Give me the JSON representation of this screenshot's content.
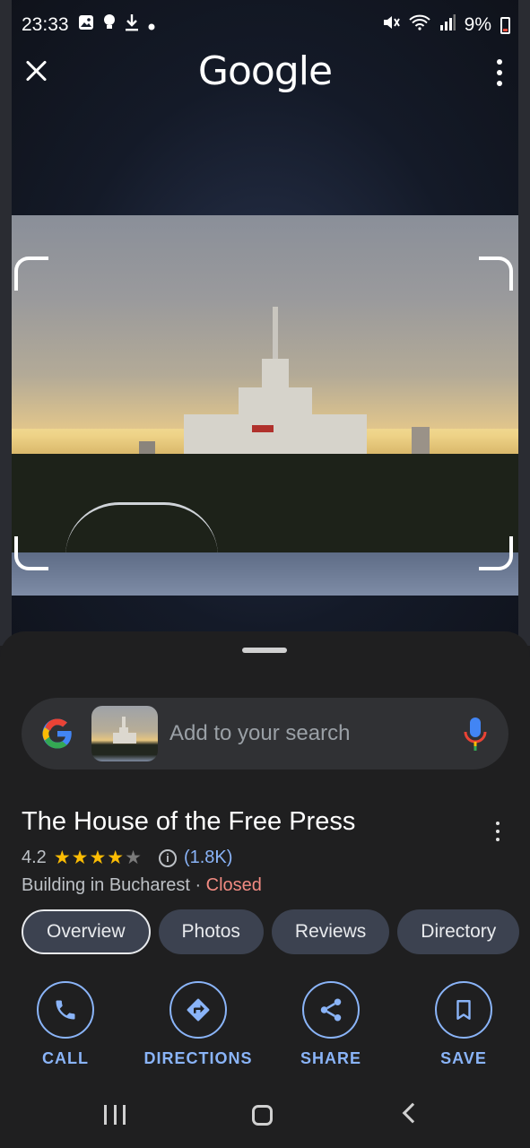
{
  "status_bar": {
    "time": "23:33",
    "battery": "9%"
  },
  "header": {
    "logo": "Google"
  },
  "search": {
    "placeholder": "Add to your search"
  },
  "place": {
    "title": "The House of the Free Press",
    "rating": "4.2",
    "stars": "★★★★",
    "half_star": "★",
    "review_count": "(1.8K)",
    "category": "Building in Bucharest",
    "separator": " · ",
    "status": "Closed"
  },
  "tabs": [
    {
      "label": "Overview",
      "active": true
    },
    {
      "label": "Photos"
    },
    {
      "label": "Reviews"
    },
    {
      "label": "Directory"
    }
  ],
  "actions": [
    {
      "label": "CALL",
      "icon": "phone-icon"
    },
    {
      "label": "DIRECTIONS",
      "icon": "directions-icon"
    },
    {
      "label": "SHARE",
      "icon": "share-icon"
    },
    {
      "label": "SAVE",
      "icon": "bookmark-icon"
    }
  ],
  "colors": {
    "accent": "#8ab4f8",
    "closed": "#f28b82",
    "star": "#fbbc04",
    "sheet": "#1f1f20"
  }
}
